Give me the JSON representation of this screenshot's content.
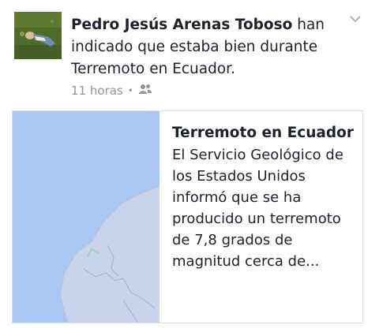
{
  "post": {
    "actor_name": "Pedro Jesús Arenas Toboso",
    "story_text": "han indicado que estaba bien durante Terremoto en Ecuador.",
    "time": "11 horas",
    "separator": "•",
    "audience_icon": "friends-icon",
    "options_icon": "chevron-down-icon"
  },
  "card": {
    "title": "Terremoto en Ecuador",
    "description": "El Servicio Geológico de los Estados Unidos informó que se ha producido un terremoto de 7,8 grados de magnitud cerca de...",
    "image_icon": "map-thumbnail"
  },
  "colors": {
    "text_primary": "#1d2129",
    "text_secondary": "#90949c",
    "ocean": "#a8c7f2",
    "land": "#c9d4ec",
    "card_border": "#dddfe2"
  }
}
